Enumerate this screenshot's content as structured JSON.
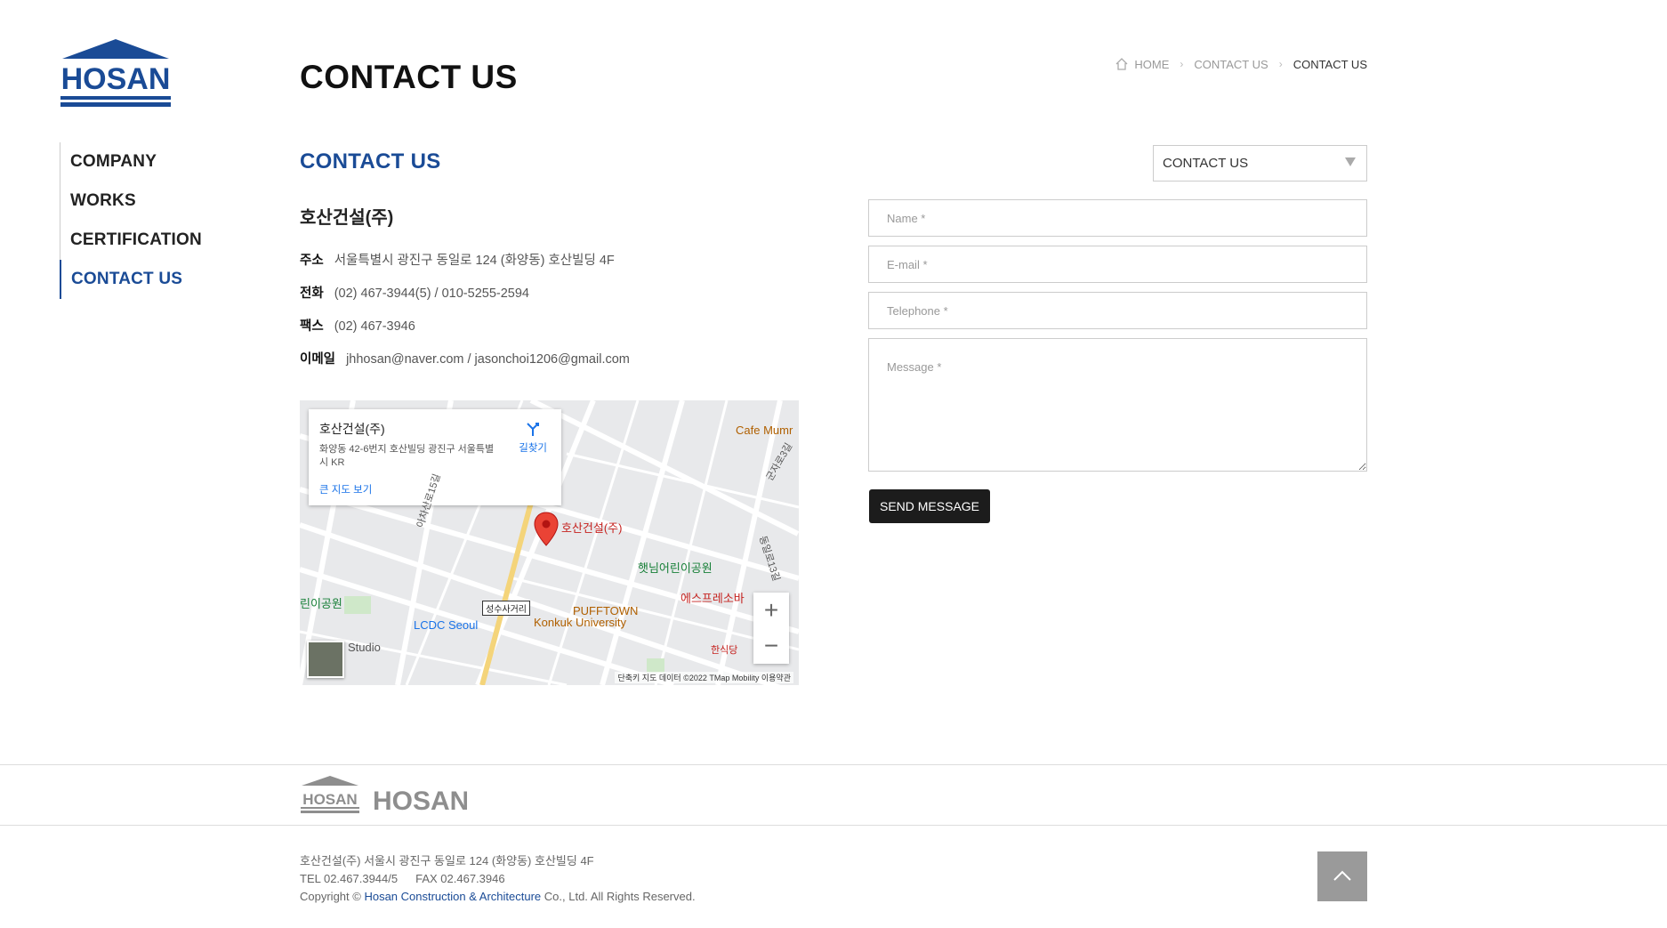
{
  "brand": {
    "logo_text": "HOSAN",
    "accent": "#1a4b96"
  },
  "nav": {
    "items": [
      {
        "label": "COMPANY",
        "active": false
      },
      {
        "label": "WORKS",
        "active": false
      },
      {
        "label": "CERTIFICATION",
        "active": false
      },
      {
        "label": "CONTACT US",
        "active": true
      }
    ]
  },
  "header": {
    "title": "CONTACT US",
    "breadcrumb": {
      "home": "HOME",
      "level1": "CONTACT US",
      "current": "CONTACT US"
    }
  },
  "section": {
    "title": "CONTACT US",
    "select_value": "CONTACT US"
  },
  "company": {
    "name": "호산건설(주)",
    "address_label": "주소",
    "address": "서울특별시 광진구 동일로 124 (화양동) 호산빌딩 4F",
    "phone_label": "전화",
    "phone": "(02) 467-3944(5) / 010-5255-2594",
    "fax_label": "팩스",
    "fax": "(02) 467-3946",
    "email_label": "이메일",
    "email": "jhhosan@naver.com / jasonchoi1206@gmail.com"
  },
  "map": {
    "card_title": "호산건설(주)",
    "card_address": "화양동 42-6번지 호산빌딩 광진구 서울특별시 KR",
    "directions": "길찾기",
    "bigger_map": "큰 지도 보기",
    "zoom_in": "+",
    "zoom_out": "−",
    "footer": "단축키   지도 데이터 ©2022 TMap Mobility   이용약관",
    "labels": {
      "marker": "호산건설(주)",
      "park": "햇님어린이공원",
      "cafe": "Cafe Mumr",
      "espresso": "에스프레소바",
      "pufftown": "PUFFTOWN",
      "konkuk": "Konkuk University",
      "lcdc": "LCDC Seoul",
      "studio": "Studio",
      "park2": "린이공원",
      "intersection": "성수사거리",
      "restaurant": "한식당",
      "street1": "아차산로15길",
      "street2": "군자로3길",
      "street3": "동일로13길"
    }
  },
  "form": {
    "name_placeholder": "Name *",
    "email_placeholder": "E-mail *",
    "phone_placeholder": "Telephone *",
    "message_placeholder": "Message *",
    "send_label": "SEND MESSAGE"
  },
  "footer": {
    "logo_text": "HOSAN",
    "wordmark": "HOSAN",
    "address": "호산건설(주) 서울시 광진구 동일로 124 (화양동) 호산빌딩 4F",
    "tel": "TEL 02.467.3944/5",
    "fax": "FAX 02.467.3946",
    "copyright_prefix": "Copyright © ",
    "copyright_link": "Hosan Construction & Architecture",
    "copyright_suffix": " Co., Ltd. All Rights Reserved."
  }
}
